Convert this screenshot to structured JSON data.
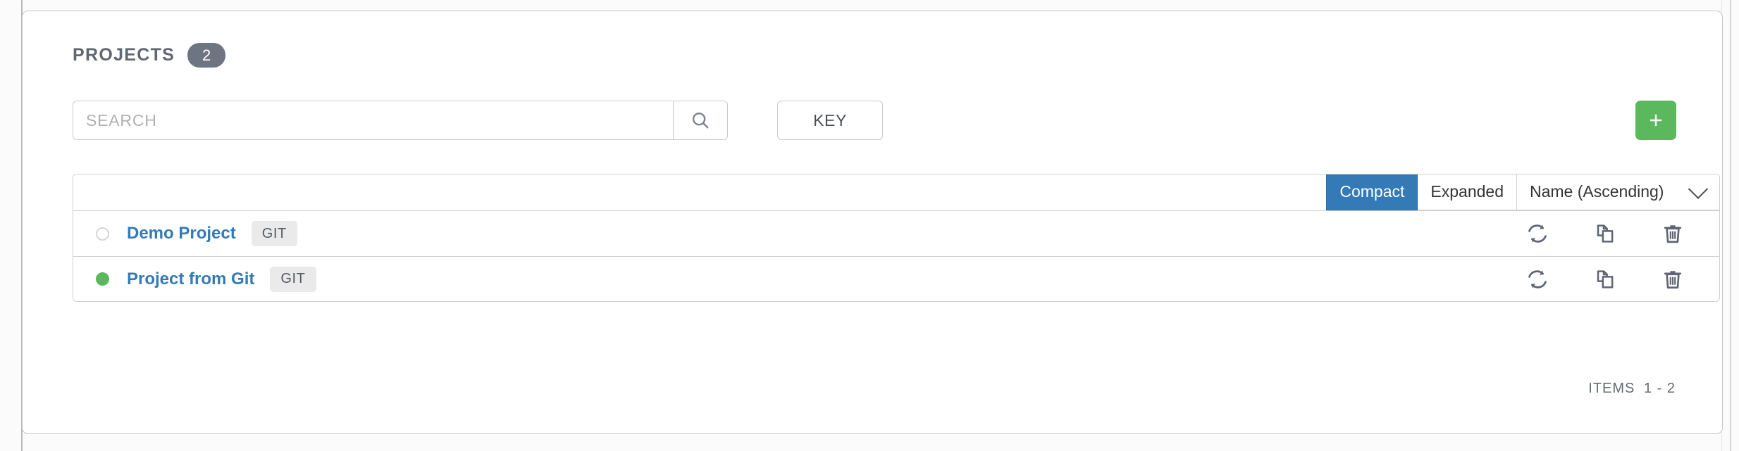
{
  "header": {
    "title": "PROJECTS",
    "count": "2"
  },
  "search": {
    "placeholder": "SEARCH",
    "value": "",
    "search_icon": "search-icon",
    "key_label": "KEY",
    "add_label": "+"
  },
  "list_toolbar": {
    "compact_label": "Compact",
    "expanded_label": "Expanded",
    "active_view": "Compact",
    "sort_label": "Name (Ascending)",
    "chevron_icon": "chevron-down-icon"
  },
  "rows": [
    {
      "status": "none",
      "name": "Demo Project",
      "type_badge": "GIT",
      "actions": {
        "sync": "sync-icon",
        "copy": "copy-icon",
        "delete": "trash-icon"
      }
    },
    {
      "status": "success",
      "name": "Project from Git",
      "type_badge": "GIT",
      "actions": {
        "sync": "sync-icon",
        "copy": "copy-icon",
        "delete": "trash-icon"
      }
    }
  ],
  "footer": {
    "items_label": "ITEMS",
    "items_range": "1 - 2"
  },
  "colors": {
    "accent_blue": "#337ab7",
    "success_green": "#5cb85c",
    "badge_gray": "#6d7582",
    "text_gray": "#606672"
  }
}
